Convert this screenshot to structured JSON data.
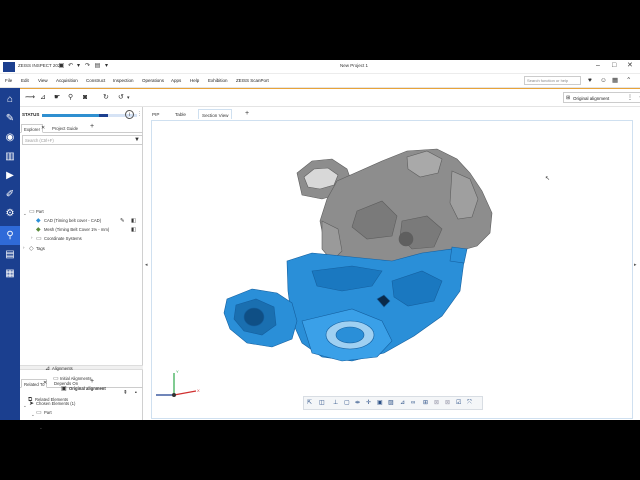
{
  "titlebar": {
    "app_name": "ZEISS INSPECT 2026",
    "document_title": "New Project 1",
    "window_controls": [
      "–",
      "□",
      "✕"
    ]
  },
  "menubar": {
    "items": [
      "File",
      "Edit",
      "View",
      "Acquisition",
      "Construct",
      "Inspection",
      "Operations",
      "Apps",
      "Help",
      "Exhibition",
      "ZEISS ScanPort"
    ],
    "search_placeholder": "Search function or help"
  },
  "toolbar": {
    "alignment_value": "Original alignment"
  },
  "sidebar": {
    "icons": [
      "home-icon",
      "tools-icon",
      "acquisition-icon",
      "library-icon",
      "camera-icon",
      "brush-icon",
      "robot-icon",
      "inspection-icon",
      "report-icon",
      "apps-icon"
    ],
    "active_index": 7
  },
  "panel": {
    "status_label": "STATUS",
    "status_progress": 0.7,
    "info_label": "i",
    "tabs": [
      "Explorer",
      "Project Guide"
    ],
    "search_placeholder": "Search (Ctrl+F)",
    "tree": [
      {
        "label": "Part",
        "level": 0
      },
      {
        "label": "CAD (Timing belt cover - CAD)",
        "level": 1
      },
      {
        "label": "Mesh (Timing Belt Cover 1% - mm)",
        "level": 1
      },
      {
        "label": "Coordinate Systems",
        "level": 1
      },
      {
        "label": "Tags",
        "level": 0
      }
    ],
    "lower_tabs": [
      "Related To",
      "Depends On"
    ],
    "lower_tree": [
      {
        "label": "Chosen Elements (1)",
        "level": 0
      },
      {
        "label": "Part",
        "level": 1
      },
      {
        "label": "Alignments",
        "level": 2
      },
      {
        "label": "Initial Alignments",
        "level": 3
      },
      {
        "label": "Original alignment",
        "level": 4
      },
      {
        "label": "Related Elements",
        "level": 0
      }
    ]
  },
  "viewport": {
    "tabs": [
      "PIP",
      "Table",
      "Section View"
    ],
    "add_tab": "+",
    "axes": {
      "x": "X",
      "y": "Y"
    },
    "colors": {
      "cad": "#8a8a8a",
      "mesh": "#2a8fd8",
      "viewport_border": "#cfe0f0"
    }
  }
}
